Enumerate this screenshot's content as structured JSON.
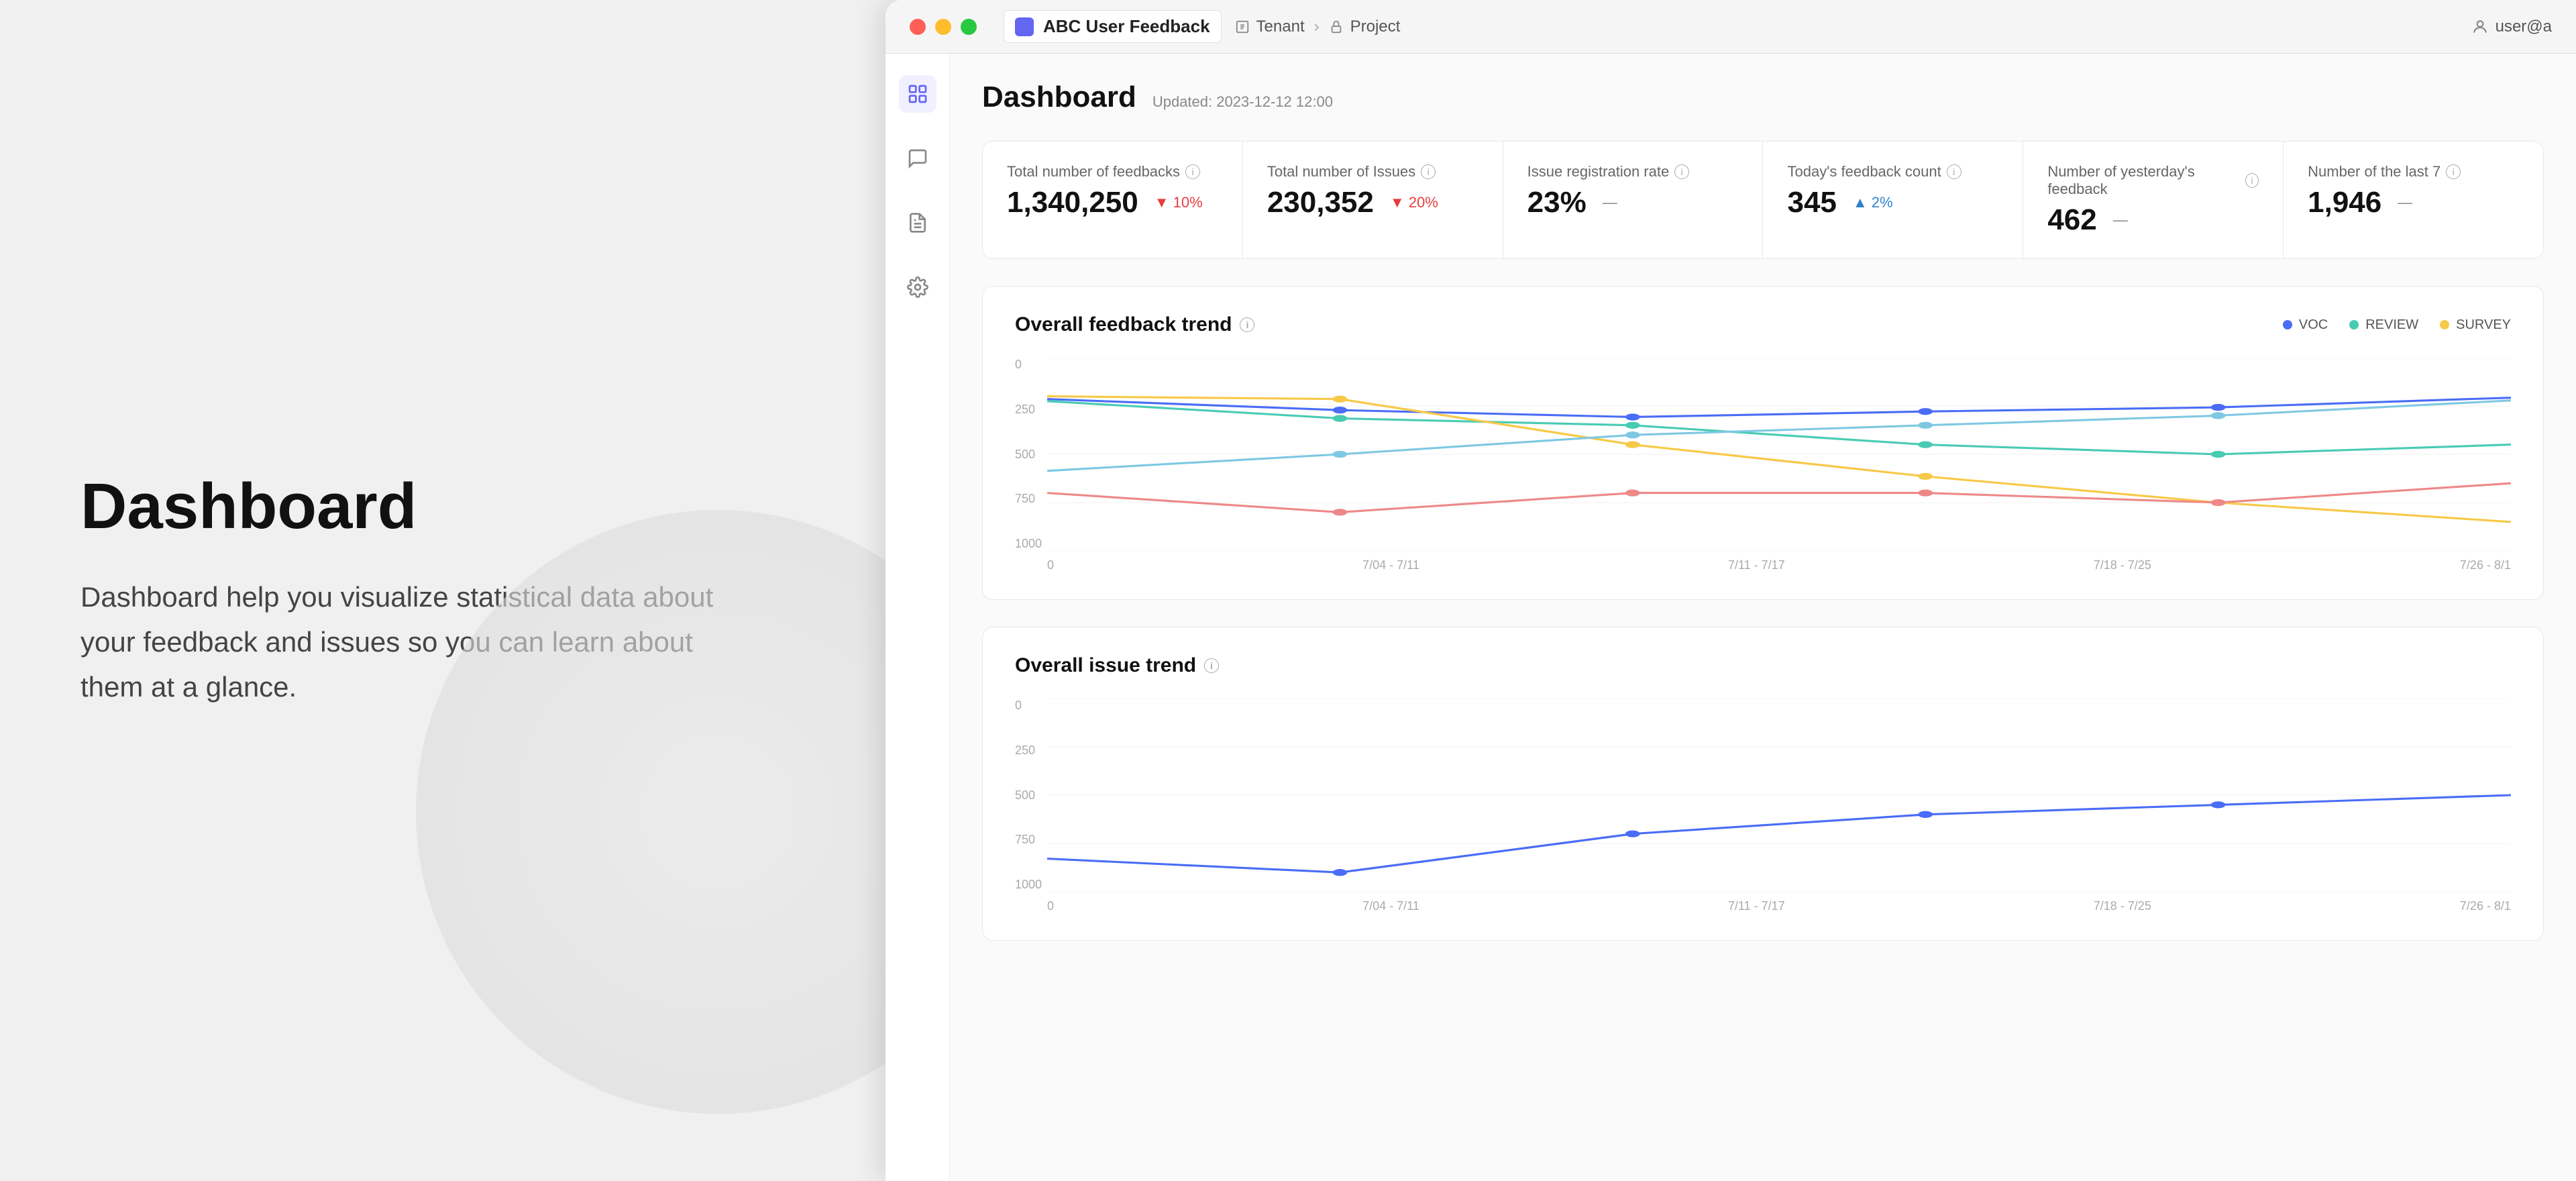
{
  "left_panel": {
    "title": "Dashboard",
    "description": "Dashboard help you visualize statistical data about your feedback and issues so you can learn about them at a glance."
  },
  "window": {
    "title_bar": {
      "app_name": "ABC User Feedback",
      "breadcrumb": [
        "Tenant",
        "Project"
      ],
      "user": "user@a"
    },
    "page": {
      "title": "Dashboard",
      "updated": "Updated: 2023-12-12 12:00"
    },
    "stats": [
      {
        "label": "Total number of feedbacks",
        "value": "1,340,250",
        "badge": "▼ 10%",
        "badge_type": "red"
      },
      {
        "label": "Total number of Issues",
        "value": "230,352",
        "badge": "▼ 20%",
        "badge_type": "red"
      },
      {
        "label": "Issue registration rate",
        "value": "23%",
        "badge": "—",
        "badge_type": "neutral"
      },
      {
        "label": "Today's feedback count",
        "value": "345",
        "badge": "▲ 2%",
        "badge_type": "blue"
      },
      {
        "label": "Number of yesterday's feedback",
        "value": "462",
        "badge": "—",
        "badge_type": "neutral"
      },
      {
        "label": "Number of the last 7",
        "value": "1,946",
        "badge": "—",
        "badge_type": "neutral"
      }
    ],
    "charts": [
      {
        "title": "Overall feedback trend",
        "legend": [
          {
            "label": "VOC",
            "color": "#4a6cf7"
          },
          {
            "label": "REVIEW",
            "color": "#48cbb3"
          },
          {
            "label": "SURVEY",
            "color": "#f7c948"
          }
        ]
      },
      {
        "title": "Overall issue trend"
      }
    ],
    "x_axis": [
      "0",
      "7/04 - 7/11",
      "7/11 - 7/17",
      "7/18 - 7/25",
      "7/26 - 8/1"
    ],
    "y_axis": [
      "0",
      "250",
      "500",
      "750",
      "1000"
    ]
  }
}
